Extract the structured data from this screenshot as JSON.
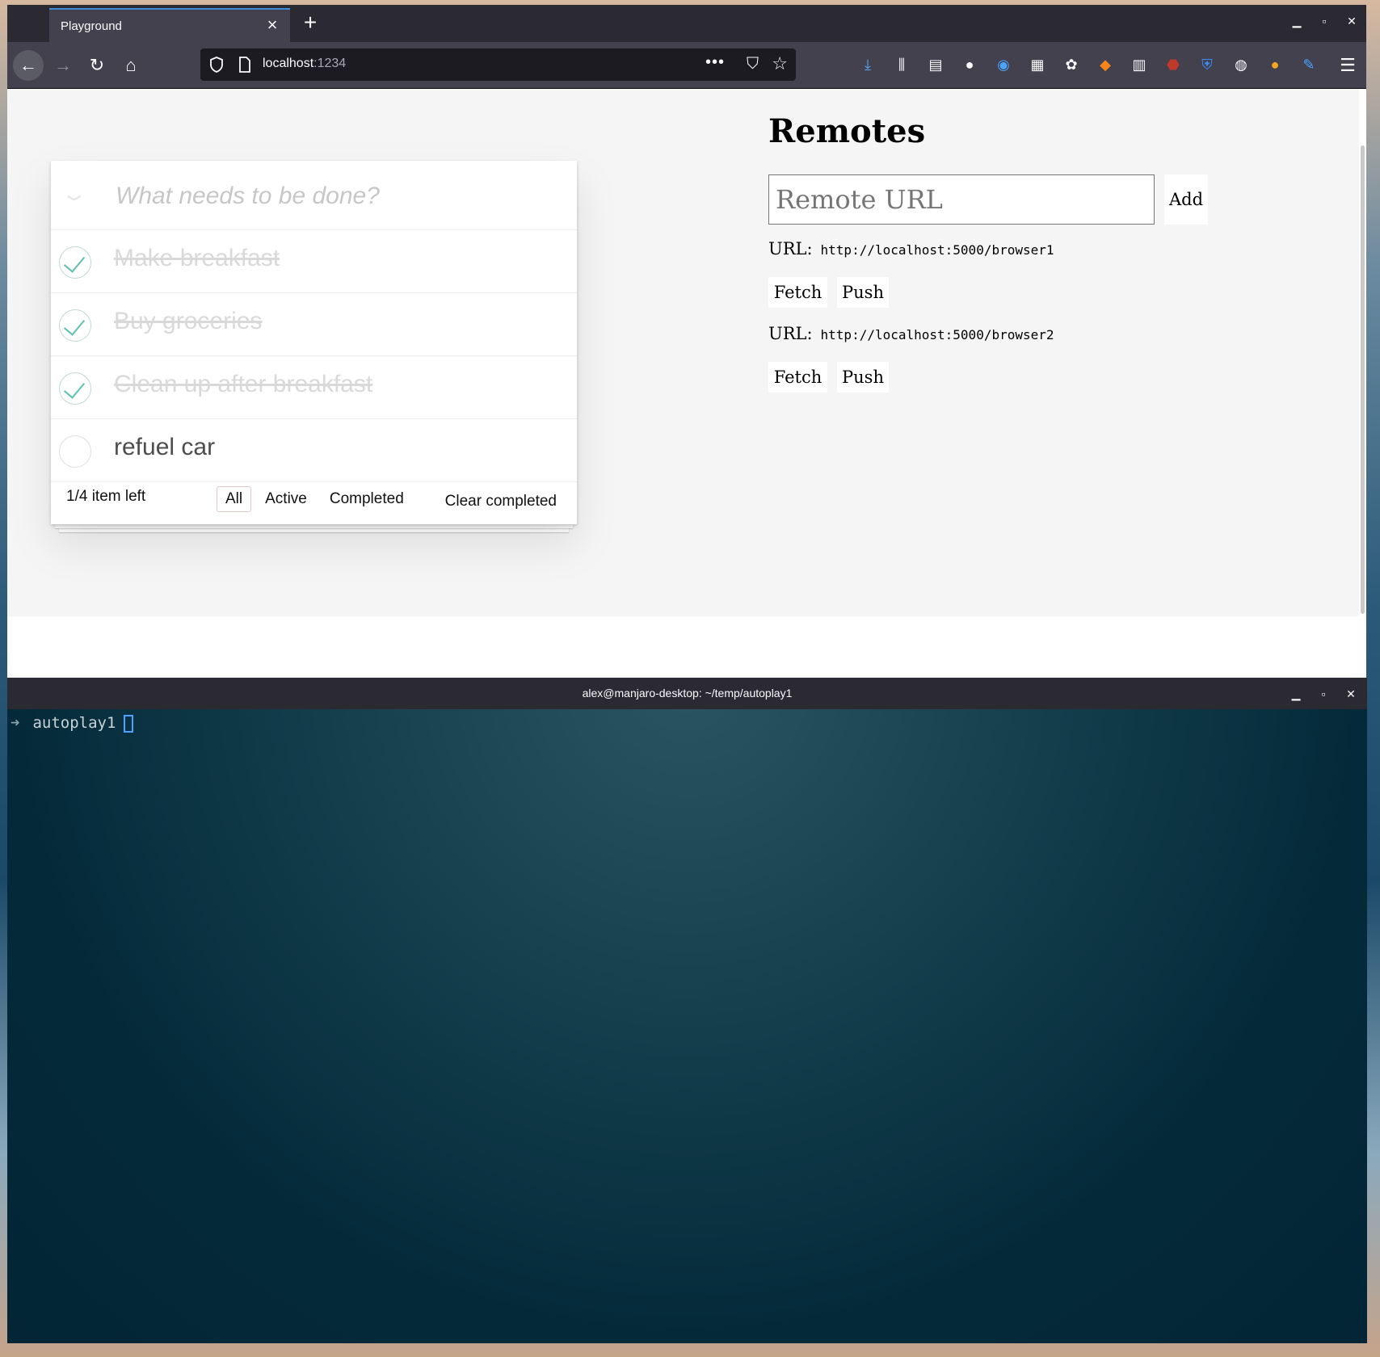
{
  "browser": {
    "tab_title": "Playground",
    "tab_close_glyph": "×",
    "new_tab_glyph": "+",
    "url_host": "localhost",
    "url_port": ":1234",
    "icons": {
      "back": "back-arrow-icon",
      "forward": "forward-arrow-icon",
      "reload": "reload-icon",
      "home": "home-icon",
      "page_actions": "more-icon",
      "pocket": "pocket-icon",
      "bookmark": "star-icon",
      "menu": "hamburger-menu-icon"
    },
    "extensions": [
      "download-icon",
      "library-icon",
      "sidebar-icon",
      "account-icon",
      "extension-blue-icon",
      "extension-grid-icon",
      "extension-paw-icon",
      "metamask-icon",
      "extension-bars-icon",
      "ublock-icon",
      "bitwarden-icon",
      "extension-mask-icon",
      "extension-orange-icon",
      "extension-wrench-icon"
    ],
    "accent_color": "#3d8bd9"
  },
  "todo": {
    "placeholder": "What needs to be done?",
    "items": [
      {
        "label": "Make breakfast",
        "completed": true
      },
      {
        "label": "Buy groceries",
        "completed": true
      },
      {
        "label": "Clean up after breakfast",
        "completed": true
      },
      {
        "label": "refuel car",
        "completed": false
      }
    ],
    "count_text": "1/4 item left",
    "filters": {
      "all": "All",
      "active": "Active",
      "completed": "Completed",
      "selected": "All"
    },
    "clear_completed": "Clear completed",
    "check_color": "#5dc2af"
  },
  "remotes": {
    "title": "Remotes",
    "input_placeholder": "Remote URL",
    "add_label": "Add",
    "list": [
      {
        "url_label": "URL:",
        "url": "http://localhost:5000/browser1",
        "fetch_label": "Fetch",
        "push_label": "Push"
      },
      {
        "url_label": "URL:",
        "url": "http://localhost:5000/browser2",
        "fetch_label": "Fetch",
        "push_label": "Push"
      }
    ]
  },
  "terminal": {
    "title": "alex@manjaro-desktop: ~/temp/autoplay1",
    "prompt_arrow": "➜",
    "directory": "autoplay1"
  }
}
